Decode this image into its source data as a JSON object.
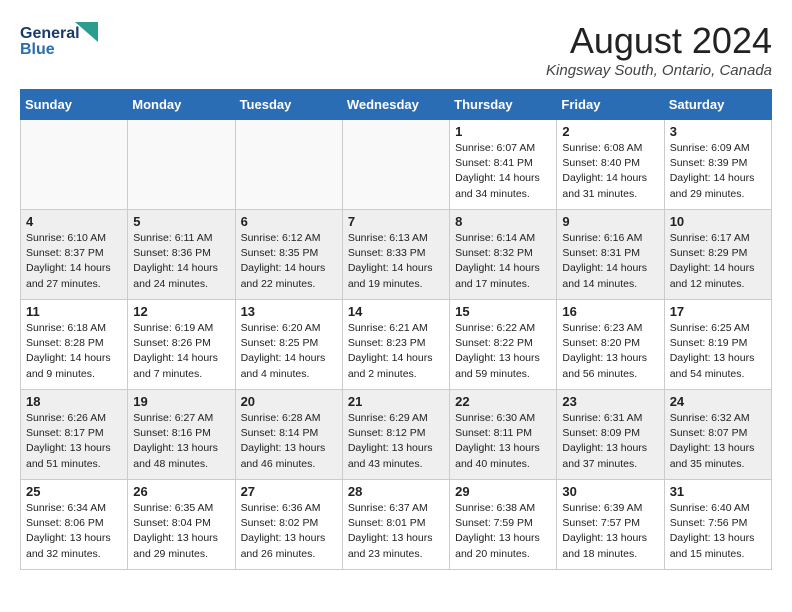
{
  "logo": {
    "line1": "General",
    "line2": "Blue"
  },
  "title": "August 2024",
  "location": "Kingsway South, Ontario, Canada",
  "weekdays": [
    "Sunday",
    "Monday",
    "Tuesday",
    "Wednesday",
    "Thursday",
    "Friday",
    "Saturday"
  ],
  "weeks": [
    [
      {
        "day": "",
        "info": ""
      },
      {
        "day": "",
        "info": ""
      },
      {
        "day": "",
        "info": ""
      },
      {
        "day": "",
        "info": ""
      },
      {
        "day": "1",
        "info": "Sunrise: 6:07 AM\nSunset: 8:41 PM\nDaylight: 14 hours\nand 34 minutes."
      },
      {
        "day": "2",
        "info": "Sunrise: 6:08 AM\nSunset: 8:40 PM\nDaylight: 14 hours\nand 31 minutes."
      },
      {
        "day": "3",
        "info": "Sunrise: 6:09 AM\nSunset: 8:39 PM\nDaylight: 14 hours\nand 29 minutes."
      }
    ],
    [
      {
        "day": "4",
        "info": "Sunrise: 6:10 AM\nSunset: 8:37 PM\nDaylight: 14 hours\nand 27 minutes."
      },
      {
        "day": "5",
        "info": "Sunrise: 6:11 AM\nSunset: 8:36 PM\nDaylight: 14 hours\nand 24 minutes."
      },
      {
        "day": "6",
        "info": "Sunrise: 6:12 AM\nSunset: 8:35 PM\nDaylight: 14 hours\nand 22 minutes."
      },
      {
        "day": "7",
        "info": "Sunrise: 6:13 AM\nSunset: 8:33 PM\nDaylight: 14 hours\nand 19 minutes."
      },
      {
        "day": "8",
        "info": "Sunrise: 6:14 AM\nSunset: 8:32 PM\nDaylight: 14 hours\nand 17 minutes."
      },
      {
        "day": "9",
        "info": "Sunrise: 6:16 AM\nSunset: 8:31 PM\nDaylight: 14 hours\nand 14 minutes."
      },
      {
        "day": "10",
        "info": "Sunrise: 6:17 AM\nSunset: 8:29 PM\nDaylight: 14 hours\nand 12 minutes."
      }
    ],
    [
      {
        "day": "11",
        "info": "Sunrise: 6:18 AM\nSunset: 8:28 PM\nDaylight: 14 hours\nand 9 minutes."
      },
      {
        "day": "12",
        "info": "Sunrise: 6:19 AM\nSunset: 8:26 PM\nDaylight: 14 hours\nand 7 minutes."
      },
      {
        "day": "13",
        "info": "Sunrise: 6:20 AM\nSunset: 8:25 PM\nDaylight: 14 hours\nand 4 minutes."
      },
      {
        "day": "14",
        "info": "Sunrise: 6:21 AM\nSunset: 8:23 PM\nDaylight: 14 hours\nand 2 minutes."
      },
      {
        "day": "15",
        "info": "Sunrise: 6:22 AM\nSunset: 8:22 PM\nDaylight: 13 hours\nand 59 minutes."
      },
      {
        "day": "16",
        "info": "Sunrise: 6:23 AM\nSunset: 8:20 PM\nDaylight: 13 hours\nand 56 minutes."
      },
      {
        "day": "17",
        "info": "Sunrise: 6:25 AM\nSunset: 8:19 PM\nDaylight: 13 hours\nand 54 minutes."
      }
    ],
    [
      {
        "day": "18",
        "info": "Sunrise: 6:26 AM\nSunset: 8:17 PM\nDaylight: 13 hours\nand 51 minutes."
      },
      {
        "day": "19",
        "info": "Sunrise: 6:27 AM\nSunset: 8:16 PM\nDaylight: 13 hours\nand 48 minutes."
      },
      {
        "day": "20",
        "info": "Sunrise: 6:28 AM\nSunset: 8:14 PM\nDaylight: 13 hours\nand 46 minutes."
      },
      {
        "day": "21",
        "info": "Sunrise: 6:29 AM\nSunset: 8:12 PM\nDaylight: 13 hours\nand 43 minutes."
      },
      {
        "day": "22",
        "info": "Sunrise: 6:30 AM\nSunset: 8:11 PM\nDaylight: 13 hours\nand 40 minutes."
      },
      {
        "day": "23",
        "info": "Sunrise: 6:31 AM\nSunset: 8:09 PM\nDaylight: 13 hours\nand 37 minutes."
      },
      {
        "day": "24",
        "info": "Sunrise: 6:32 AM\nSunset: 8:07 PM\nDaylight: 13 hours\nand 35 minutes."
      }
    ],
    [
      {
        "day": "25",
        "info": "Sunrise: 6:34 AM\nSunset: 8:06 PM\nDaylight: 13 hours\nand 32 minutes."
      },
      {
        "day": "26",
        "info": "Sunrise: 6:35 AM\nSunset: 8:04 PM\nDaylight: 13 hours\nand 29 minutes."
      },
      {
        "day": "27",
        "info": "Sunrise: 6:36 AM\nSunset: 8:02 PM\nDaylight: 13 hours\nand 26 minutes."
      },
      {
        "day": "28",
        "info": "Sunrise: 6:37 AM\nSunset: 8:01 PM\nDaylight: 13 hours\nand 23 minutes."
      },
      {
        "day": "29",
        "info": "Sunrise: 6:38 AM\nSunset: 7:59 PM\nDaylight: 13 hours\nand 20 minutes."
      },
      {
        "day": "30",
        "info": "Sunrise: 6:39 AM\nSunset: 7:57 PM\nDaylight: 13 hours\nand 18 minutes."
      },
      {
        "day": "31",
        "info": "Sunrise: 6:40 AM\nSunset: 7:56 PM\nDaylight: 13 hours\nand 15 minutes."
      }
    ]
  ]
}
